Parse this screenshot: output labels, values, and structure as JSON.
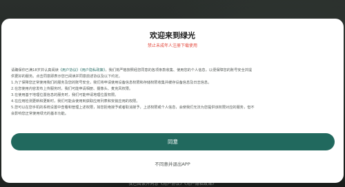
{
  "background": {
    "caption": "我已阅读并同意《用户协议》《用户隐私政策》"
  },
  "dialog": {
    "title": "欢迎来到绿光",
    "warning": "禁止未成年人注册下载使用",
    "intro": {
      "before": "请确保你已满18岁并认真阅读",
      "link1": "《用户协议》",
      "link2": "《用户隐私政策》",
      "after": "，我们将严格按照经您同意的各项条款收集、使用您的个人信息，以便保障您的账号安全并提"
    },
    "lines": [
      "供更好的服务。点击同意即表示您已阅读并同意前述协议及以下约定。",
      "1.为了保障您正常使用我们的服务及您的账号安全，我们将申请使用设备信息权限和存储权限收集并缓存设备信息及日志信息。",
      "2.在您使用内容发布上传服务时，我们可能申请相册、摄像头、麦克风权限。",
      "3.在使用基于地理位置信息的服务时，我们可能申请地理位置权限。",
      "4.在应用检测更新和更新时，我们可能会使用到获取应用列表和安装应用的权限。",
      "5.您可以在您手机的系统设置中查看和管理上述权限，如您拒绝授予或者取消授予，上述权限或个人信息，会使我们无法为您提供该权限对应的服务，但不",
      "会影响您正常使用绿光的基本功能。"
    ],
    "agree_label": "同意",
    "exit_label": "不同意并退出APP"
  },
  "colors": {
    "accent": "#21695e",
    "warning": "#e3463a",
    "link": "#2b6f67"
  }
}
